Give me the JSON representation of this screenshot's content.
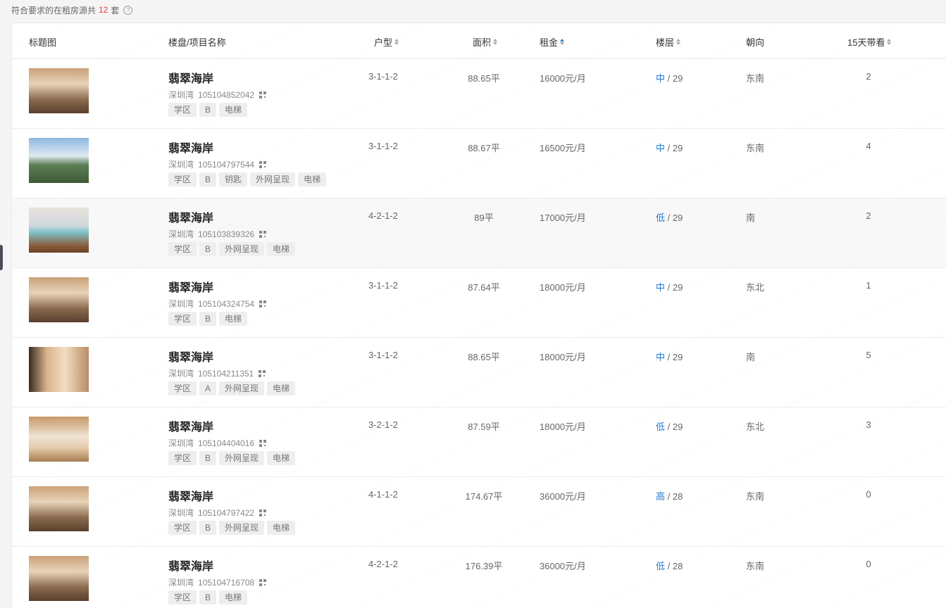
{
  "summary": {
    "prefix": "符合要求的在租房源共",
    "count": "12",
    "suffix": "套",
    "help_icon": "question-circle-icon"
  },
  "columns": {
    "image": "标题图",
    "name": "楼盘/项目名称",
    "layout": "户型",
    "area": "面积",
    "rent": "租金",
    "floor": "楼层",
    "orientation": "朝向",
    "views": "15天带看"
  },
  "colors": {
    "accent": "#1f7ad1",
    "count": "#e4393c"
  },
  "rows": [
    {
      "title": "翡翠海岸",
      "district": "深圳湾",
      "code": "105104852042",
      "tags": [
        "学区",
        "B",
        "电梯"
      ],
      "layout": "3-1-1-2",
      "area": "88.65平",
      "rent": "16000元/月",
      "floor_level": "中",
      "floor_total": "/ 29",
      "orientation": "东南",
      "views": "2",
      "thumb": "living-room-photo"
    },
    {
      "title": "翡翠海岸",
      "district": "深圳湾",
      "code": "105104797544",
      "tags": [
        "学区",
        "B",
        "钥匙",
        "外网呈现",
        "电梯"
      ],
      "layout": "3-1-1-2",
      "area": "88.67平",
      "rent": "16500元/月",
      "floor_level": "中",
      "floor_total": "/ 29",
      "orientation": "东南",
      "views": "4",
      "thumb": "sea-view-photo"
    },
    {
      "title": "翡翠海岸",
      "district": "深圳湾",
      "code": "105103839326",
      "tags": [
        "学区",
        "B",
        "外网呈现",
        "电梯"
      ],
      "layout": "4-2-1-2",
      "area": "89平",
      "rent": "17000元/月",
      "floor_level": "低",
      "floor_total": "/ 29",
      "orientation": "南",
      "views": "2",
      "thumb": "sofa-photo"
    },
    {
      "title": "翡翠海岸",
      "district": "深圳湾",
      "code": "105104324754",
      "tags": [
        "学区",
        "B",
        "电梯"
      ],
      "layout": "3-1-1-2",
      "area": "87.64平",
      "rent": "18000元/月",
      "floor_level": "中",
      "floor_total": "/ 29",
      "orientation": "东北",
      "views": "1",
      "thumb": "living-room-photo"
    },
    {
      "title": "翡翠海岸",
      "district": "深圳湾",
      "code": "105104211351",
      "tags": [
        "学区",
        "A",
        "外网呈现",
        "电梯"
      ],
      "layout": "3-1-1-2",
      "area": "88.65平",
      "rent": "18000元/月",
      "floor_level": "中",
      "floor_total": "/ 29",
      "orientation": "南",
      "views": "5",
      "thumb": "bedroom-photo"
    },
    {
      "title": "翡翠海岸",
      "district": "深圳湾",
      "code": "105104404016",
      "tags": [
        "学区",
        "B",
        "外网呈现",
        "电梯"
      ],
      "layout": "3-2-1-2",
      "area": "87.59平",
      "rent": "18000元/月",
      "floor_level": "低",
      "floor_total": "/ 29",
      "orientation": "东北",
      "views": "3",
      "thumb": "dining-photo"
    },
    {
      "title": "翡翠海岸",
      "district": "深圳湾",
      "code": "105104797422",
      "tags": [
        "学区",
        "B",
        "外网呈现",
        "电梯"
      ],
      "layout": "4-1-1-2",
      "area": "174.67平",
      "rent": "36000元/月",
      "floor_level": "高",
      "floor_total": "/ 28",
      "orientation": "东南",
      "views": "0",
      "thumb": "living-room-photo"
    },
    {
      "title": "翡翠海岸",
      "district": "深圳湾",
      "code": "105104716708",
      "tags": [
        "学区",
        "B",
        "电梯"
      ],
      "layout": "4-2-1-2",
      "area": "176.39平",
      "rent": "36000元/月",
      "floor_level": "低",
      "floor_total": "/ 28",
      "orientation": "东南",
      "views": "0",
      "thumb": "living-room-photo"
    }
  ]
}
